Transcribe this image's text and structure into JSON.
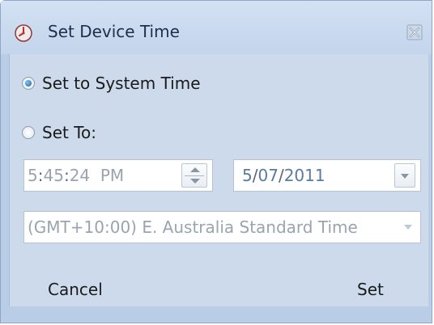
{
  "window": {
    "title": "Set Device Time",
    "icon": "clock-icon",
    "close_icon": "close-icon"
  },
  "options": {
    "system_time_label": "Set to System Time",
    "system_time_checked": true,
    "set_to_label": "Set To:",
    "set_to_checked": false
  },
  "time": {
    "hours": "5",
    "minutes": "45",
    "seconds": "24",
    "ampm": "PM"
  },
  "date": {
    "day": "5",
    "month": "07",
    "year": "2011"
  },
  "timezone": {
    "selected": "(GMT+10:00) E. Australia Standard Time"
  },
  "buttons": {
    "cancel_label": "Cancel",
    "set_label": "Set"
  },
  "colors": {
    "window_background": "#ccdaeb",
    "title_text": "#1d2f4d",
    "radio_selected": "#1b5fa8",
    "disabled_text": "#9aa4b0"
  }
}
